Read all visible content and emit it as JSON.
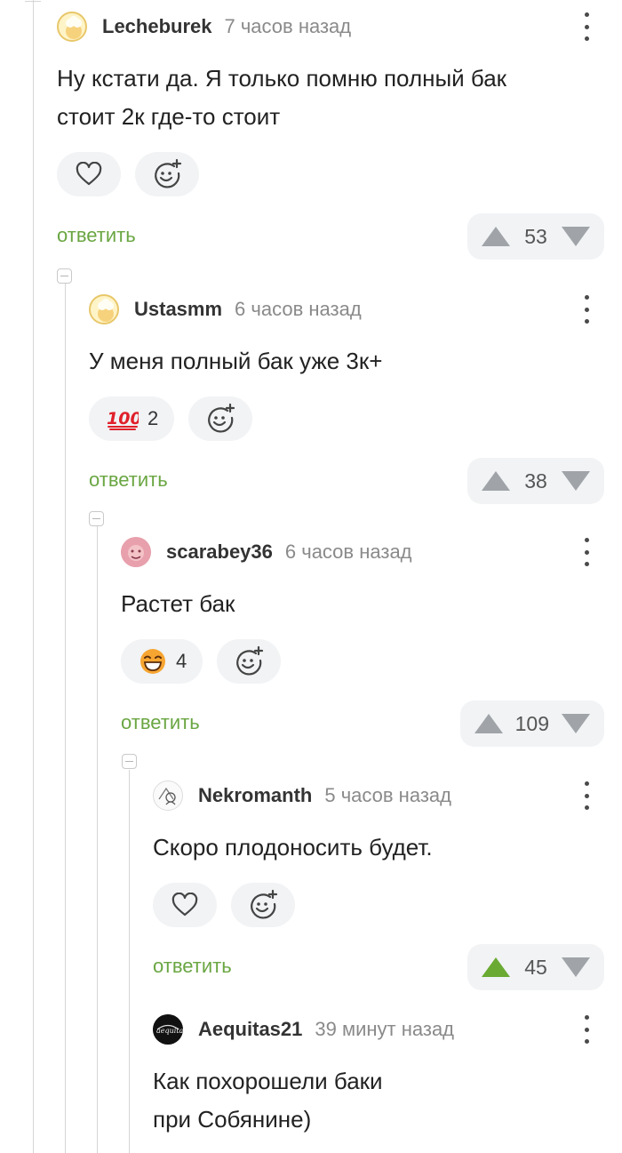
{
  "colors": {
    "reply_link": "#6aa642",
    "vote_up_active": "#6aaa32",
    "vote_inactive": "#a0a4a8",
    "pill_background": "#f1f3f5"
  },
  "comments": [
    {
      "username": "Lecheburek",
      "time": "7 часов назад",
      "text": [
        "Ну кстати да. Я только помню полный бак",
        "стоит 2к где-то стоит"
      ],
      "reactions": [
        {
          "icon": "heart-icon"
        },
        {
          "icon": "add-reaction-icon"
        }
      ],
      "reply_label": "ответить",
      "rating": "53",
      "upvoted": false
    },
    {
      "username": "Ustasmm",
      "time": "6 часов назад",
      "text": [
        "У меня полный бак уже 3к+"
      ],
      "reactions": [
        {
          "icon": "hundred-emoji",
          "count": "2"
        },
        {
          "icon": "add-reaction-icon"
        }
      ],
      "reply_label": "ответить",
      "rating": "38",
      "upvoted": false
    },
    {
      "username": "scarabey36",
      "time": "6 часов назад",
      "text": [
        "Растет бак"
      ],
      "reactions": [
        {
          "icon": "grinning-emoji",
          "count": "4"
        },
        {
          "icon": "add-reaction-icon"
        }
      ],
      "reply_label": "ответить",
      "rating": "109",
      "upvoted": false
    },
    {
      "username": "Nekromanth",
      "time": "5 часов назад",
      "text": [
        "Скоро плодоносить будет."
      ],
      "reactions": [
        {
          "icon": "heart-icon"
        },
        {
          "icon": "add-reaction-icon"
        }
      ],
      "reply_label": "ответить",
      "rating": "45",
      "upvoted": true
    },
    {
      "username": "Aequitas21",
      "time": "39 минут назад",
      "text": [
        "Как похорошели баки",
        "при Собянине)"
      ]
    }
  ]
}
